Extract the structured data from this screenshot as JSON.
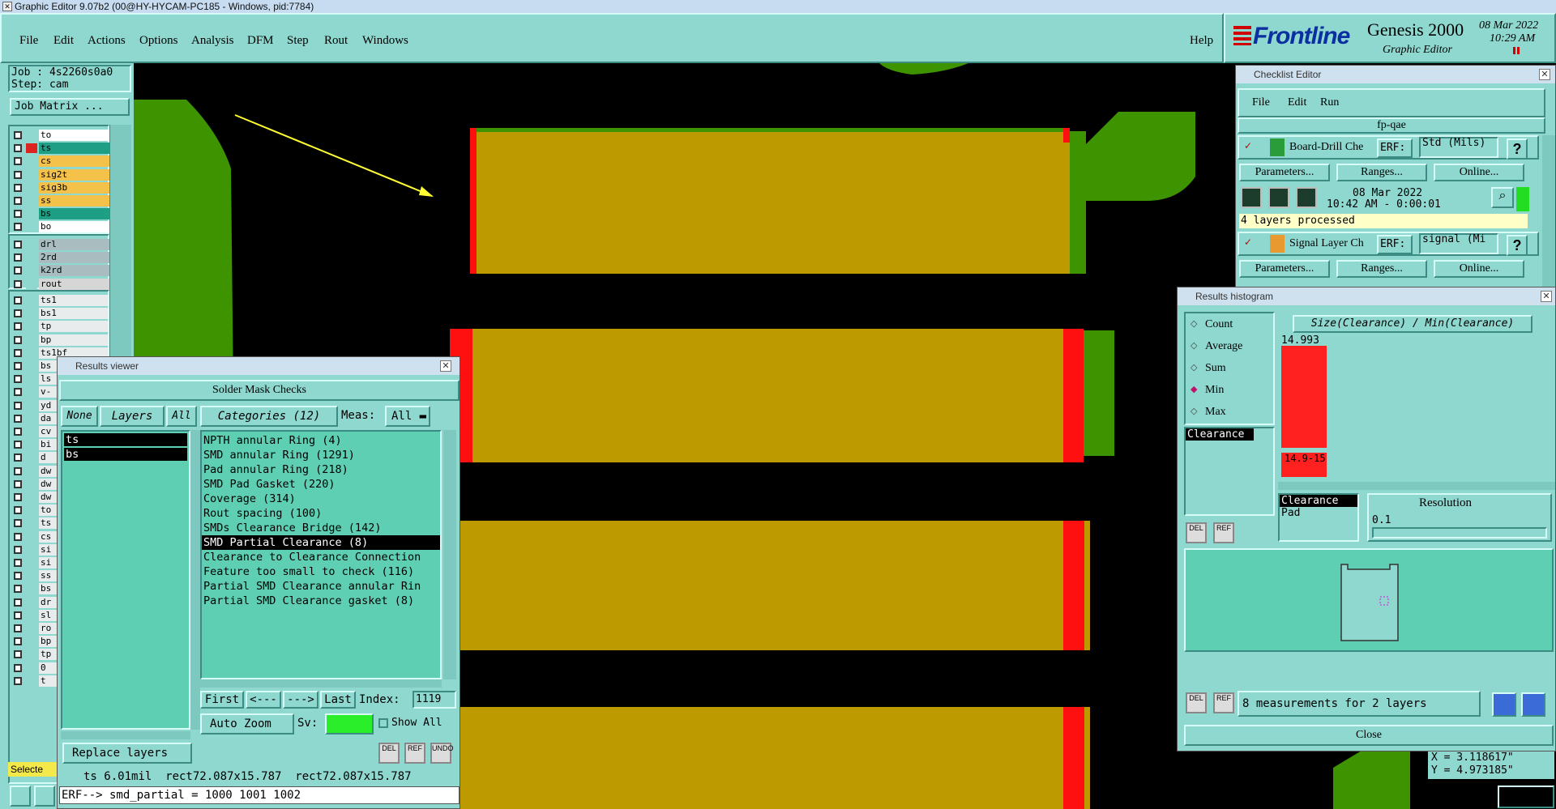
{
  "app": {
    "title": "Graphic Editor 9.07b2 (00@HY-HYCAM-PC185 - Windows, pid:7784)"
  },
  "menu": [
    "File",
    "Edit",
    "Actions",
    "Options",
    "Analysis",
    "DFM",
    "Step",
    "Rout",
    "Windows"
  ],
  "help": "Help",
  "brand": {
    "logo": "Frontline",
    "product": "Genesis 2000",
    "subtitle": "Graphic Editor",
    "date": "08 Mar 2022",
    "time": "10:29 AM"
  },
  "job": {
    "job_line": "Job : 4s2260s0a0",
    "step_line": "Step: cam",
    "matrix_button": "Job Matrix ..."
  },
  "layers_group1": [
    {
      "name": "to",
      "color": "#ffffff"
    },
    {
      "name": "ts",
      "color": "#1e9e84"
    },
    {
      "name": "cs",
      "color": "#f4c14a"
    },
    {
      "name": "sig2t",
      "color": "#f4c14a"
    },
    {
      "name": "sig3b",
      "color": "#f4c14a"
    },
    {
      "name": "ss",
      "color": "#f4c14a"
    },
    {
      "name": "bs",
      "color": "#1e9e84"
    },
    {
      "name": "bo",
      "color": "#ffffff"
    }
  ],
  "layers_group2": [
    {
      "name": "drl",
      "color": "#a9bdc0"
    },
    {
      "name": "2rd",
      "color": "#a9bdc0"
    },
    {
      "name": "k2rd",
      "color": "#a9bdc0"
    },
    {
      "name": "rout",
      "color": "#d6d6d6"
    }
  ],
  "layers_group3": [
    "ts1",
    "bs1",
    "tp",
    "bp",
    "ts1bf",
    "bs",
    "ls",
    "v-",
    "yd",
    "da",
    "cv",
    "bi",
    "d",
    "dw",
    "dw",
    "dw",
    "to",
    "ts",
    "cs",
    "si",
    "si",
    "ss",
    "bs",
    "dr",
    "sl",
    "ro",
    "bp",
    "tp",
    "0",
    "t"
  ],
  "selected_label": "Selecte",
  "checklist": {
    "title": "Checklist Editor",
    "menu": [
      "File",
      "Edit",
      "Run"
    ],
    "name": "fp-qae",
    "items": [
      {
        "name": "Board-Drill Che",
        "erf": "ERF:",
        "erf_value": "Std (Mils)",
        "date": "08 Mar 2022",
        "time": "10:42 AM - 0:00:01",
        "status": "4 layers processed"
      },
      {
        "name": "Signal Layer Ch",
        "erf": "ERF:",
        "erf_value": "signal (Mi"
      }
    ],
    "buttons": [
      "Parameters...",
      "Ranges...",
      "Online..."
    ],
    "help_icon": "?"
  },
  "results_viewer": {
    "title": "Results viewer",
    "header": "Solder Mask Checks",
    "none_btn": "None",
    "layers_label": "Layers",
    "all_btn": "All",
    "categories_label": "Categories (12)",
    "meas_label": "Meas:",
    "meas_value": "All",
    "layers": [
      "ts",
      "bs"
    ],
    "categories": [
      "NPTH annular Ring (4)",
      "SMD annular Ring (1291)",
      "Pad annular Ring (218)",
      "SMD Pad Gasket (220)",
      "Coverage (314)",
      "Rout spacing (100)",
      "SMDs Clearance Bridge (142)",
      "SMD Partial Clearance (8)",
      "Clearance to Clearance Connection",
      "Feature too small to check (116)",
      "Partial SMD Clearance annular Rin",
      "Partial SMD Clearance gasket (8)"
    ],
    "selected_category": "SMD Partial Clearance (8)",
    "nav": {
      "first": "First",
      "prev": "<---",
      "next": "--->",
      "last": "Last",
      "index_label": "Index:",
      "index_value": "1119"
    },
    "auto_zoom": "Auto Zoom",
    "sv_label": "Sv:",
    "show_all": "Show All",
    "replace_layers": "Replace layers",
    "status_line": "ts 6.01mil  rect72.087x15.787  rect72.087x15.787",
    "erf_line": "ERF--> smd_partial = 1000 1001 1002",
    "icons": [
      "DEL",
      "REF",
      "UNDO"
    ]
  },
  "histogram": {
    "title": "Results histogram",
    "modes": [
      "Count",
      "Average",
      "Sum",
      "Min",
      "Max"
    ],
    "selected_mode": "Min",
    "measure_list": [
      "Clearance"
    ],
    "chart_title": "Size(Clearance) / Min(Clearance)",
    "max_value": "14.993",
    "bin_label": "14.9-15",
    "feature_list": [
      "Clearance",
      "Pad"
    ],
    "resolution_label": "Resolution",
    "resolution_value": "0.1",
    "summary": "8 measurements for 2 layers",
    "close": "Close",
    "icons": [
      "DEL",
      "REF"
    ]
  },
  "coords": {
    "x": "X = 3.118617\"",
    "y": "Y = 4.973185\""
  },
  "units": "Inch",
  "colors": {
    "panel": "#8ed8d0",
    "pad": "#bd9b00",
    "copper": "#3e9400",
    "violation": "#ff1010",
    "arrow": "#ffff33",
    "list": "#5fcfb4"
  }
}
